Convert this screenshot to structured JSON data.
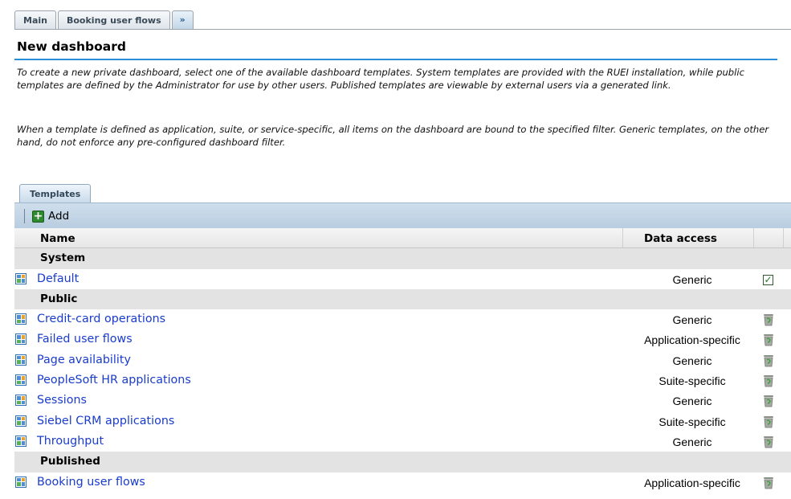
{
  "top_tabs": {
    "main": "Main",
    "booking": "Booking user flows",
    "more": "»"
  },
  "page": {
    "title": "New dashboard",
    "intro_1": "To create a new private dashboard, select one of the available dashboard templates. System templates are provided with the RUEI installation, while public templates are defined by the Administrator for use by other users. Published templates are viewable by external users via a generated link.",
    "intro_2": "When a template is defined as application, suite, or service-specific, all items on the dashboard are bound to the specified filter. Generic templates, on the other hand, do not enforce any pre-configured dashboard filter."
  },
  "section_tab": "Templates",
  "toolbar": {
    "add_label": "Add"
  },
  "table": {
    "col_name": "Name",
    "col_access": "Data access",
    "groups": {
      "system": "System",
      "public": "Public",
      "published": "Published"
    },
    "rows": [
      {
        "name": "Default",
        "access": "Generic",
        "action": "checkbox"
      },
      {
        "name": "Credit-card operations",
        "access": "Generic",
        "action": "delete"
      },
      {
        "name": "Failed user flows",
        "access": "Application-specific",
        "action": "delete"
      },
      {
        "name": "Page availability",
        "access": "Generic",
        "action": "delete"
      },
      {
        "name": "PeopleSoft HR applications",
        "access": "Suite-specific",
        "action": "delete"
      },
      {
        "name": "Sessions",
        "access": "Generic",
        "action": "delete"
      },
      {
        "name": "Siebel CRM applications",
        "access": "Suite-specific",
        "action": "delete"
      },
      {
        "name": "Throughput",
        "access": "Generic",
        "action": "delete"
      },
      {
        "name": "Booking user flows",
        "access": "Application-specific",
        "action": "delete"
      }
    ]
  },
  "icons": {
    "row_icon": "dashboard-template-icon",
    "delete_icon": "trash-can-icon",
    "check_icon": "checkmark-checkbox-icon",
    "add_icon": "plus-icon"
  },
  "colors": {
    "accent_rule": "#2a8ed8",
    "link": "#1a3ccc",
    "toolbar": "#c4d6e7"
  }
}
